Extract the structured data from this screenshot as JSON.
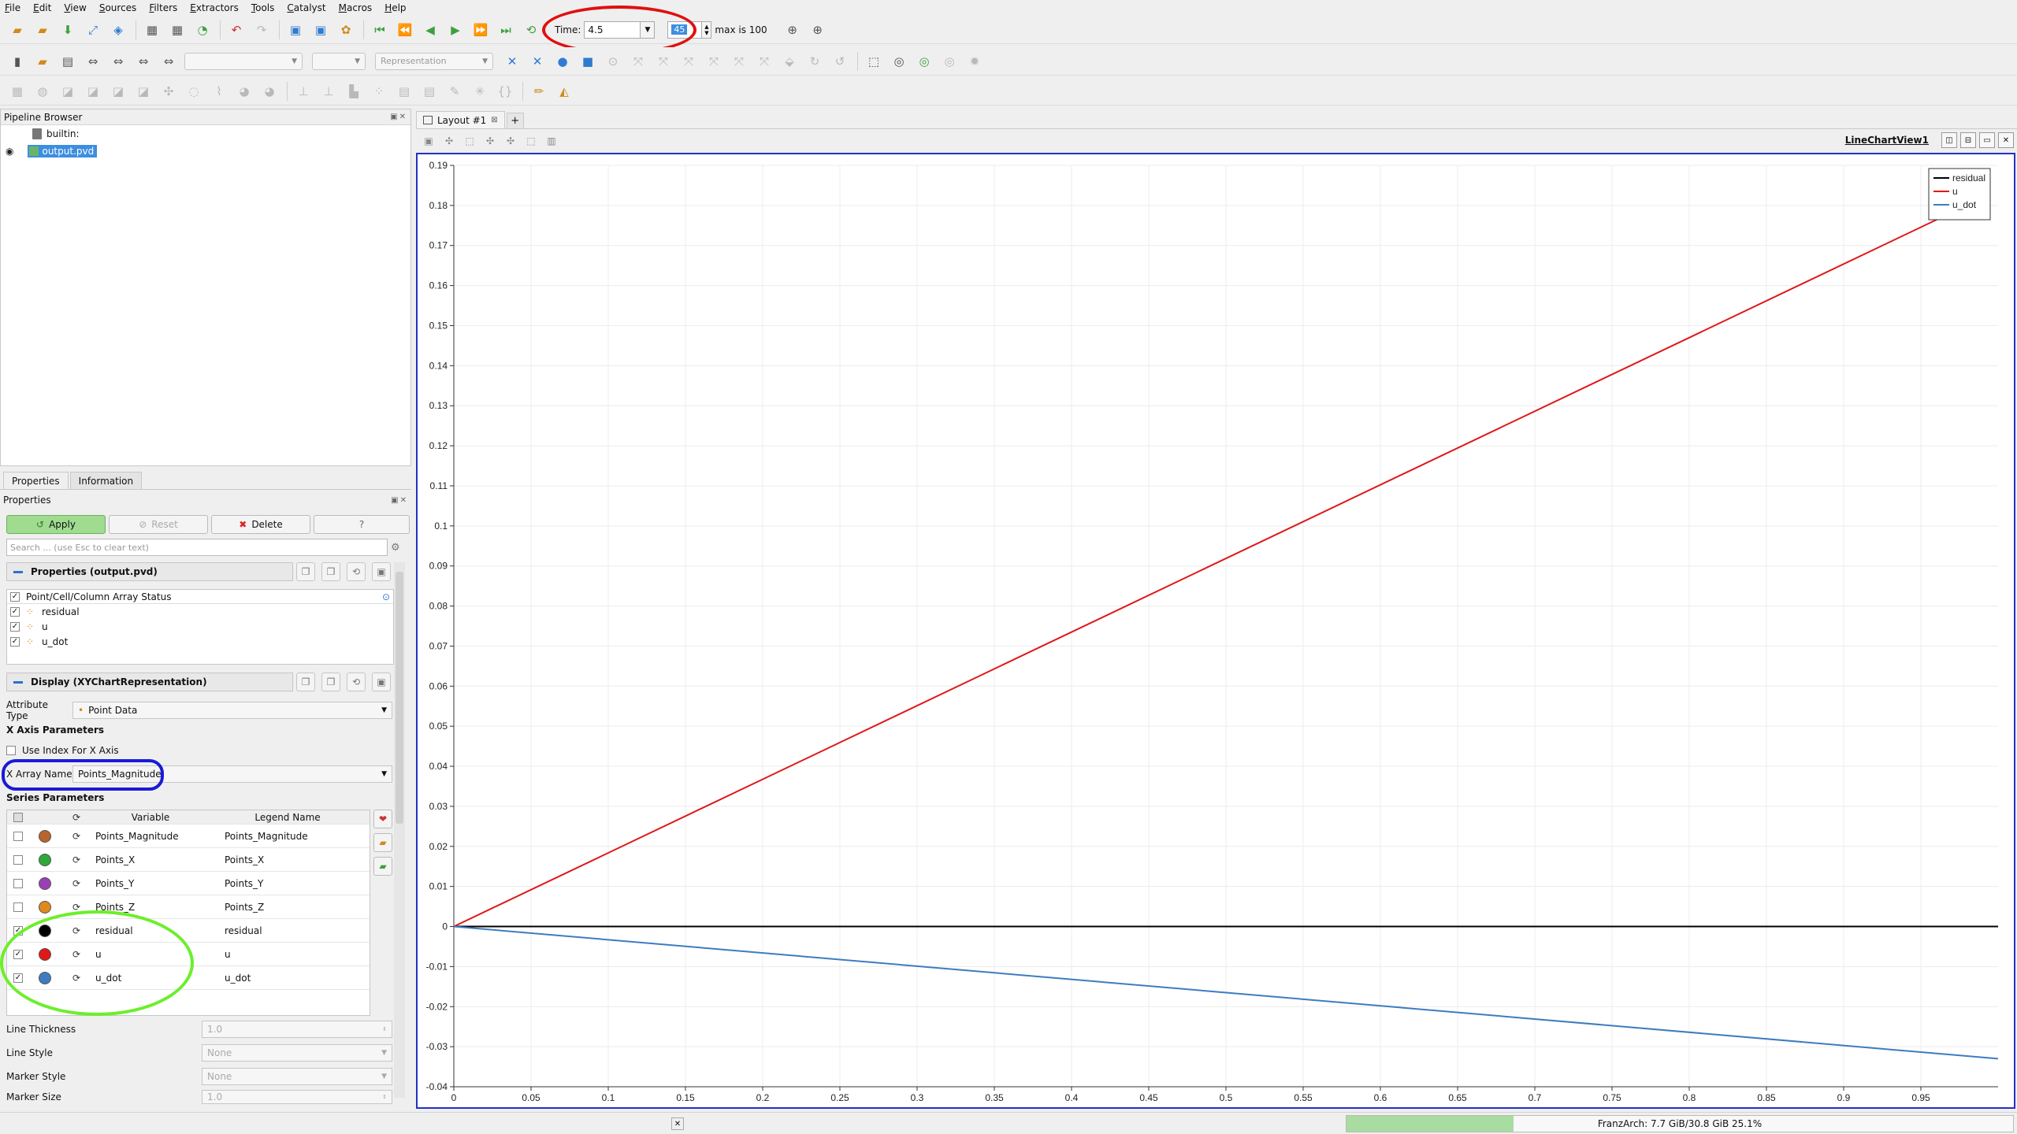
{
  "menu": [
    "File",
    "Edit",
    "View",
    "Sources",
    "Filters",
    "Extractors",
    "Tools",
    "Catalyst",
    "Macros",
    "Help"
  ],
  "time": {
    "label": "Time:",
    "value": "4.5",
    "step": "45",
    "max_label": "max is 100"
  },
  "toolbar2": {
    "representation_placeholder": "Representation"
  },
  "pipeline": {
    "title": "Pipeline Browser",
    "builtin": "builtin:",
    "source": "output.pvd"
  },
  "tabs": {
    "properties": "Properties",
    "information": "Information"
  },
  "properties": {
    "title": "Properties",
    "apply": "Apply",
    "reset": "Reset",
    "delete": "Delete",
    "help": "?",
    "search_placeholder": "Search ... (use Esc to clear text)",
    "section_props": "Properties (output.pvd)",
    "array_status_header": "Point/Cell/Column Array Status",
    "arrays": [
      "residual",
      "u",
      "u_dot"
    ],
    "section_display": "Display (XYChartRepresentation)",
    "attribute_type_label": "Attribute Type",
    "attribute_type_value": "Point Data",
    "x_axis_params": "X Axis Parameters",
    "use_index": "Use Index For X Axis",
    "x_array_label": "X Array Name",
    "x_array_value": "Points_Magnitude",
    "series_params": "Series Parameters",
    "series_headers": {
      "variable": "Variable",
      "legend": "Legend Name"
    },
    "series": [
      {
        "variable": "Points_Magnitude",
        "legend": "Points_Magnitude",
        "checked": false,
        "color": "#b8642a"
      },
      {
        "variable": "Points_X",
        "legend": "Points_X",
        "checked": false,
        "color": "#2ea83a"
      },
      {
        "variable": "Points_Y",
        "legend": "Points_Y",
        "checked": false,
        "color": "#9b3fb5"
      },
      {
        "variable": "Points_Z",
        "legend": "Points_Z",
        "checked": false,
        "color": "#e08a1c"
      },
      {
        "variable": "residual",
        "legend": "residual",
        "checked": true,
        "color": "#000000"
      },
      {
        "variable": "u",
        "legend": "u",
        "checked": true,
        "color": "#e01818"
      },
      {
        "variable": "u_dot",
        "legend": "u_dot",
        "checked": true,
        "color": "#3d7cc0"
      }
    ],
    "line_thickness_label": "Line Thickness",
    "line_thickness_value": "1.0",
    "line_style_label": "Line Style",
    "line_style_value": "None",
    "marker_style_label": "Marker Style",
    "marker_style_value": "None",
    "marker_size_label": "Marker Size",
    "marker_size_value": "1.0"
  },
  "layout": {
    "tab": "Layout #1",
    "add": "+",
    "view_name": "LineChartView1"
  },
  "status": {
    "memory": "FranzArch: 7.7 GiB/30.8 GiB 25.1%",
    "memory_fraction": 0.251
  },
  "chart_data": {
    "type": "line",
    "title": "",
    "xlabel": "",
    "ylabel": "",
    "xlim": [
      0,
      1
    ],
    "ylim": [
      -0.04,
      0.19
    ],
    "x_ticks": [
      "0",
      "0.05",
      "0.1",
      "0.15",
      "0.2",
      "0.25",
      "0.3",
      "0.35",
      "0.4",
      "0.45",
      "0.5",
      "0.55",
      "0.6",
      "0.65",
      "0.7",
      "0.75",
      "0.8",
      "0.85",
      "0.9",
      "0.95"
    ],
    "y_ticks": [
      "0.19",
      "0.18",
      "0.17",
      "0.16",
      "0.15",
      "0.14",
      "0.13",
      "0.12",
      "0.11",
      "0.1",
      "0.09",
      "0.08",
      "0.07",
      "0.06",
      "0.05",
      "0.04",
      "0.03",
      "0.02",
      "0.01",
      "0",
      "-0.01",
      "-0.02",
      "-0.03",
      "-0.04"
    ],
    "grid": true,
    "legend_position": "top-right",
    "series": [
      {
        "name": "residual",
        "color": "#000000",
        "x": [
          0,
          1
        ],
        "y": [
          0,
          0
        ]
      },
      {
        "name": "u",
        "color": "#e01818",
        "x": [
          0,
          0.985
        ],
        "y": [
          0,
          0.181
        ]
      },
      {
        "name": "u_dot",
        "color": "#3d7cc0",
        "x": [
          0,
          1
        ],
        "y": [
          0,
          -0.033
        ]
      }
    ]
  }
}
